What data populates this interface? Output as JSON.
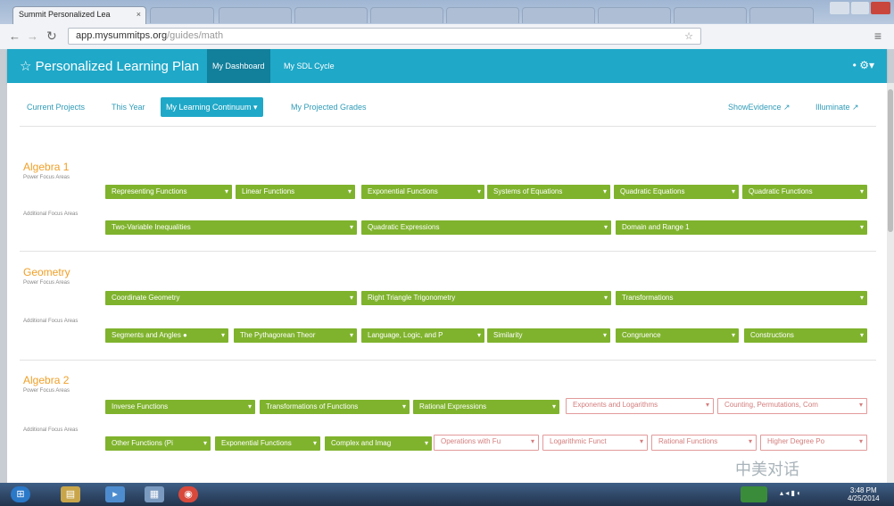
{
  "browser": {
    "tab_title": "Summit Personalized Lea",
    "tab_close": "×",
    "url_host": "app.mysummitps.org",
    "url_path": "/guides/math"
  },
  "header": {
    "brand": "☆ Personalized Learning Plan",
    "nav": [
      "My Dashboard",
      "My SDL Cycle"
    ],
    "right_icons": "•   ⚙▾"
  },
  "subnav": {
    "items": [
      "Current Projects",
      "This Year",
      "My Learning Continuum ▾",
      "My Projected Grades"
    ],
    "right_links": [
      "ShowEvidence ↗",
      "Illuminate ↗"
    ]
  },
  "labels": {
    "power": "Power Focus Areas",
    "additional": "Additional Focus Areas"
  },
  "sections": [
    {
      "title": "Algebra 1",
      "power": [
        {
          "label": "Representing Functions",
          "status": "green"
        },
        {
          "label": "Linear Functions",
          "status": "green"
        },
        {
          "label": "Exponential Functions",
          "status": "green"
        },
        {
          "label": "Systems of Equations",
          "status": "green"
        },
        {
          "label": "Quadratic Equations",
          "status": "green"
        },
        {
          "label": "Quadratic Functions",
          "status": "green"
        }
      ],
      "additional": [
        {
          "label": "Two-Variable Inequalities",
          "status": "green"
        },
        {
          "label": "Quadratic Expressions",
          "status": "green"
        },
        {
          "label": "Domain and Range 1",
          "status": "green"
        }
      ]
    },
    {
      "title": "Geometry",
      "power": [
        {
          "label": "Coordinate Geometry",
          "status": "green"
        },
        {
          "label": "Right Triangle Trigonometry",
          "status": "green"
        },
        {
          "label": "Transformations",
          "status": "green"
        }
      ],
      "additional": [
        {
          "label": "Segments and Angles ●",
          "status": "green"
        },
        {
          "label": "The Pythagorean Theor",
          "status": "green"
        },
        {
          "label": "Language, Logic, and P",
          "status": "green"
        },
        {
          "label": "Similarity",
          "status": "green"
        },
        {
          "label": "Congruence",
          "status": "green"
        },
        {
          "label": "Constructions",
          "status": "green"
        }
      ]
    },
    {
      "title": "Algebra 2",
      "power": [
        {
          "label": "Inverse Functions",
          "status": "green"
        },
        {
          "label": "Transformations of Functions",
          "status": "green"
        },
        {
          "label": "Rational Expressions",
          "status": "green"
        },
        {
          "label": "Exponents and Logarithms",
          "status": "red"
        },
        {
          "label": "Counting, Permutations, Com",
          "status": "red"
        }
      ],
      "additional": [
        {
          "label": "Other Functions (Pi",
          "status": "green"
        },
        {
          "label": "Exponential Functions",
          "status": "green"
        },
        {
          "label": "Complex and Imag",
          "status": "green"
        },
        {
          "label": "Operations with Fu",
          "status": "red"
        },
        {
          "label": "Logarithmic Funct",
          "status": "red"
        },
        {
          "label": "Rational Functions",
          "status": "red"
        },
        {
          "label": "Higher Degree Po",
          "status": "red"
        }
      ]
    }
  ],
  "watermark": "中美对话",
  "taskbar": {
    "time": "3:48 PM",
    "date": "4/25/2014"
  },
  "colors": {
    "accent": "#1fa8c8",
    "section_title": "#f0a028",
    "mastered": "#7fb32d",
    "not_mastered": "#e39a9a"
  }
}
